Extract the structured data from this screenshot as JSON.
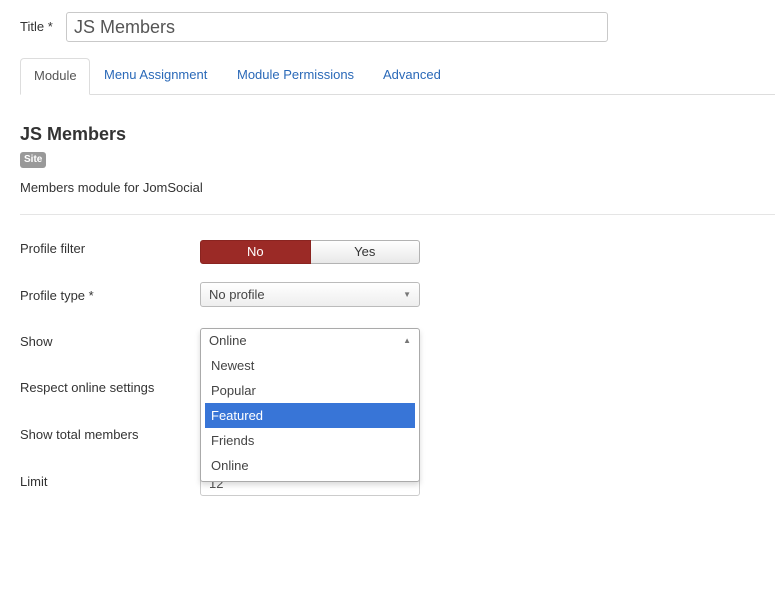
{
  "title_field": {
    "label": "Title *",
    "value": "JS Members"
  },
  "tabs": [
    {
      "label": "Module",
      "active": true
    },
    {
      "label": "Menu Assignment",
      "active": false
    },
    {
      "label": "Module Permissions",
      "active": false
    },
    {
      "label": "Advanced",
      "active": false
    }
  ],
  "module": {
    "name": "JS Members",
    "badge": "Site",
    "description": "Members module for JomSocial"
  },
  "fields": {
    "profile_filter": {
      "label": "Profile filter",
      "options": [
        "No",
        "Yes"
      ],
      "selected": "No"
    },
    "profile_type": {
      "label": "Profile type *",
      "value": "No profile"
    },
    "show": {
      "label": "Show",
      "value": "Online",
      "options": [
        "Newest",
        "Popular",
        "Featured",
        "Friends",
        "Online"
      ],
      "highlighted": "Featured"
    },
    "respect_online": {
      "label": "Respect online settings"
    },
    "show_total": {
      "label": "Show total members"
    },
    "limit": {
      "label": "Limit",
      "value": "12"
    }
  },
  "colors": {
    "link": "#2a69b8",
    "toggle_no": "#9b2a26",
    "highlight": "#3875d7",
    "badge": "#999999"
  }
}
